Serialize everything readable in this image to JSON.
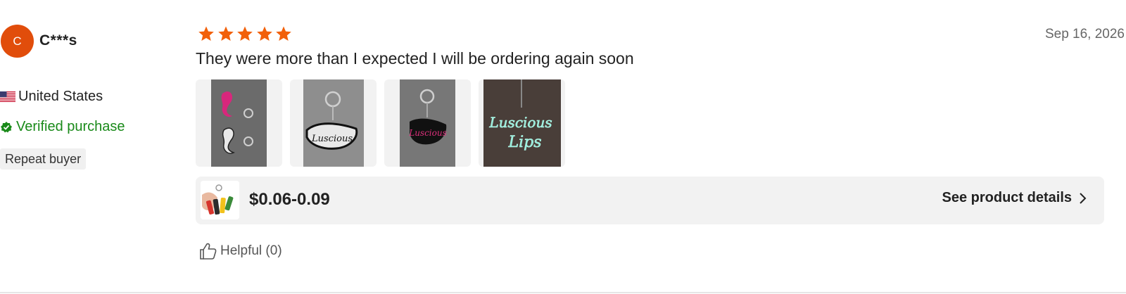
{
  "reviewer": {
    "avatar_letter": "C",
    "name": "C***s",
    "avatar_color": "#e14d0b",
    "country": "United States",
    "country_flag_icon": "us-flag-icon",
    "verified_label": "Verified purchase",
    "verified_color": "#1a8a1a",
    "badge": "Repeat buyer"
  },
  "review": {
    "rating": 5,
    "star_color": "#f2600a",
    "date": "Sep 16, 2026",
    "text": "They were more than I expected I will be ordering again soon",
    "photos": [
      {
        "name": "photo-pink-and-white-keychains"
      },
      {
        "name": "photo-white-keychain"
      },
      {
        "name": "photo-pink-keychain"
      },
      {
        "name": "photo-glow-keychain"
      }
    ]
  },
  "product": {
    "price": "$0.06-0.09",
    "details_label": "See product details",
    "details_icon": "chevron-right-icon"
  },
  "helpful": {
    "label": "Helpful (0)",
    "icon": "thumbs-up-icon"
  }
}
